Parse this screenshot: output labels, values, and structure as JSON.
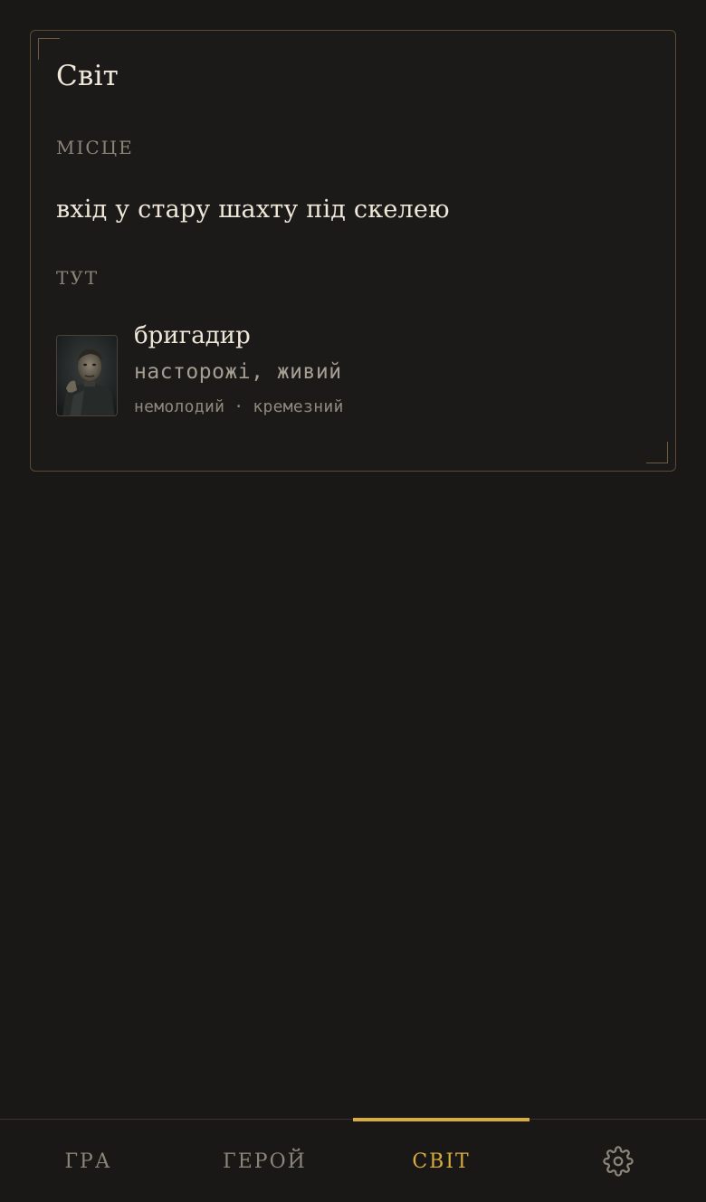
{
  "panel": {
    "title": "Світ",
    "place_label": "МІСЦЕ",
    "place_value": "вхід у стару шахту під скелею",
    "here_label": "ТУТ"
  },
  "npc": {
    "name": "бригадир",
    "state": "насторожі, живий",
    "traits": [
      "немолодий",
      "кремезний"
    ],
    "trait_separator": "·"
  },
  "nav": {
    "tabs": [
      {
        "label": "ГРА",
        "active": false
      },
      {
        "label": "ГЕРОЙ",
        "active": false
      },
      {
        "label": "СВІТ",
        "active": true
      }
    ],
    "settings_icon": "gear-icon"
  },
  "colors": {
    "background": "#1a1816",
    "accent": "#d9ac3e",
    "panel_border": "#5a4a34",
    "text_primary": "#efe8da",
    "text_muted": "#8b8478"
  }
}
